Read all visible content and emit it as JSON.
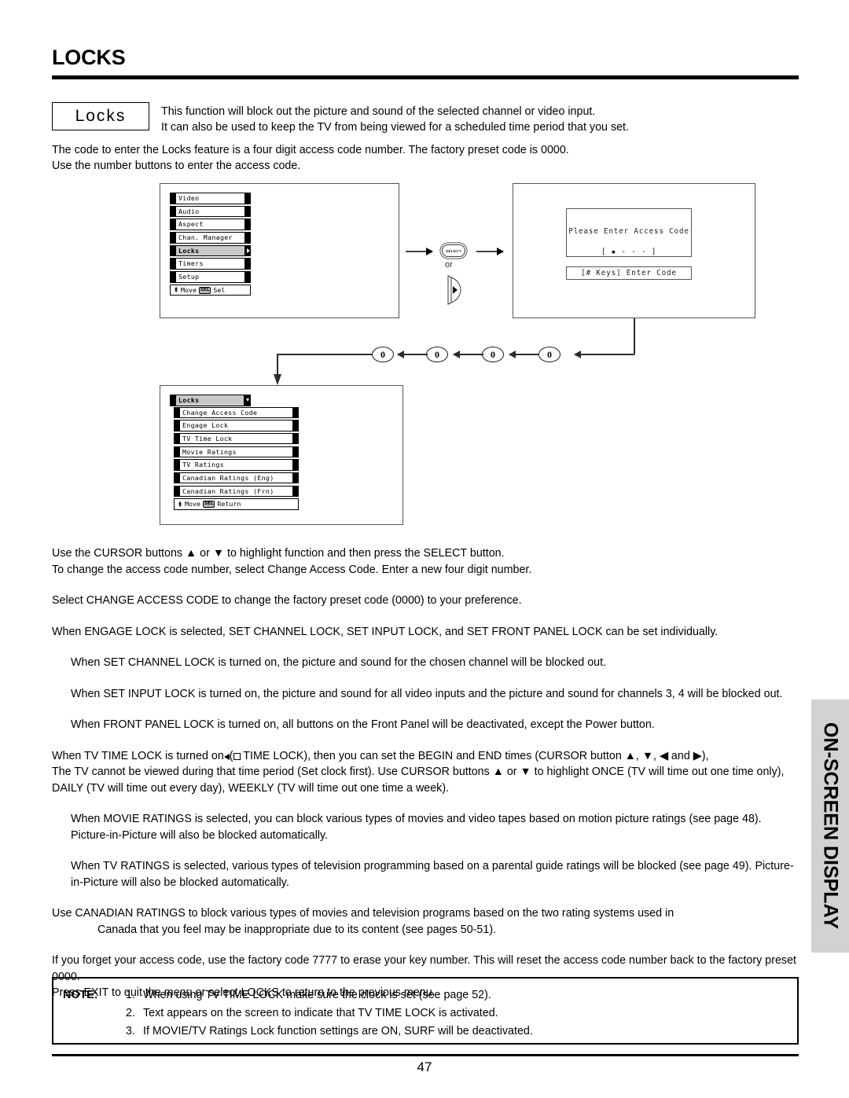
{
  "page": {
    "title": "LOCKS",
    "number": "47",
    "side_tab": "ON-SCREEN DISPLAY"
  },
  "intro": {
    "chip_label": "Locks",
    "line1": "This function will block out the picture and sound of the selected channel or video input.",
    "line2": "It can also be used to keep the TV from being viewed for a scheduled time period that you set.",
    "lead1": "The code to enter the Locks feature is a four digit access code number.  The factory preset code is 0000.",
    "lead2": "Use the number buttons to enter the access code."
  },
  "diagram": {
    "main_menu": {
      "items": [
        {
          "label": "Video",
          "selected": false
        },
        {
          "label": "Audio",
          "selected": false
        },
        {
          "label": "Aspect",
          "selected": false
        },
        {
          "label": "Chan. Manager",
          "selected": false
        },
        {
          "label": "Locks",
          "selected": true
        },
        {
          "label": "Timers",
          "selected": false
        },
        {
          "label": "Setup",
          "selected": false
        }
      ],
      "footer_move": "Move",
      "footer_key": "SEL",
      "footer_action": "Sel"
    },
    "select_key_label": "SELECT",
    "or_label": "or",
    "access_code": {
      "prompt": "Please Enter Access Code",
      "field": "[ ▪ - - - ]",
      "hint": "[# Keys] Enter Code"
    },
    "digits": [
      "0",
      "0",
      "0",
      "0"
    ],
    "locks_menu": {
      "header": "Locks",
      "items": [
        "Change Access Code",
        "Engage Lock",
        "TV Time Lock",
        "Movie Ratings",
        "TV Ratings",
        "Canadian Ratings (Eng)",
        "Canadian Ratings (Frn)"
      ],
      "footer_move": "Move",
      "footer_key": "SEL",
      "footer_action": "Return"
    }
  },
  "body": {
    "p1a": "Use the CURSOR buttons ▲ or ▼ to highlight function and then press the SELECT button.",
    "p1b": "To change the access code number, select Change Access Code.  Enter a new four digit number.",
    "p2": "Select CHANGE ACCESS CODE to change the factory preset code (0000) to your preference.",
    "p3": "When ENGAGE LOCK is selected, SET CHANNEL LOCK, SET INPUT LOCK, and SET FRONT PANEL LOCK can be set individually.",
    "p4": "When SET CHANNEL LOCK is turned on, the picture and sound for the chosen channel will be blocked out.",
    "p5": "When SET INPUT LOCK is turned on, the picture and sound for all video inputs and the picture and sound for channels 3, 4 will be blocked out.",
    "p6": "When FRONT PANEL LOCK is turned on, all buttons on the Front Panel will be deactivated, except the Power button.",
    "p7_a": "When TV TIME LOCK is turned on",
    "p7_b": " TIME LOCK), then you can set the BEGIN and END times (CURSOR button ▲, ▼, ◀ and ▶),",
    "p7_c": "The TV cannot be viewed during that time period (Set clock first). Use CURSOR buttons ▲ or ▼ to highlight ONCE (TV will time out one time only), DAILY (TV will time out every day), WEEKLY (TV will time out one time a week).",
    "p8": "When MOVIE RATINGS is selected, you can block various types of movies and video tapes based on motion picture ratings (see page 48). Picture-in-Picture will also be blocked automatically.",
    "p9": "When TV RATINGS is selected, various types of television programming based on a parental guide ratings will be blocked (see page 49). Picture-in-Picture will also be blocked automatically.",
    "p10_a": "Use CANADIAN RATINGS to block various types of movies and television programs based on the two rating systems used in",
    "p10_b": "Canada that you feel may be inappropriate due to its content (see pages 50-51).",
    "p11_a": "If you forget your access code, use the factory code 7777 to erase your key number. This will reset the access code number back to the factory preset 0000.",
    "p11_b": "Press EXIT to quit the menu or select LOCKS to return to the previous menu."
  },
  "note": {
    "label": "NOTE:",
    "items": [
      {
        "num": "1.",
        "text": "When using TV TIME LOCK make sure the clock is set (see page 52)."
      },
      {
        "num": "2.",
        "text": "Text appears on the screen to indicate that TV TIME LOCK is activated."
      },
      {
        "num": "3.",
        "text": "If MOVIE/TV Ratings Lock function settings are ON, SURF will be deactivated."
      }
    ]
  }
}
